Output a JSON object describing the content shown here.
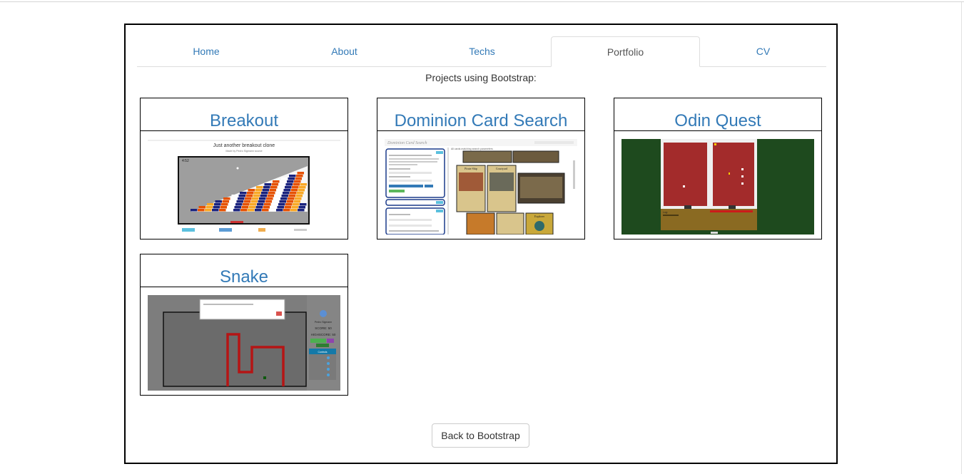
{
  "nav": {
    "tabs": [
      {
        "label": "Home"
      },
      {
        "label": "About"
      },
      {
        "label": "Techs"
      },
      {
        "label": "Portfolio"
      },
      {
        "label": "CV"
      }
    ],
    "active_tab": "Portfolio"
  },
  "portfolio": {
    "subtitle": "Projects using Bootstrap:",
    "projects": [
      {
        "title": "Breakout",
        "thumb_heading": "Just another breakout clone",
        "thumb_byline": "Made by Pedro Sigmann  source",
        "thumb_score": "4:52"
      },
      {
        "title": "Dominion Card Search",
        "thumb_brand": "Dominion Card Search",
        "thumb_results": "All cards matching search parameters",
        "thumb_card_names": [
          "Pirate Ship",
          "Courtyard",
          "Explorer"
        ]
      },
      {
        "title": "Odin Quest",
        "thumb_log_label": "Log:"
      },
      {
        "title": "Snake",
        "thumb_player": "Pedro Sigmann",
        "thumb_score": "SCORE: 50",
        "thumb_highscore": "HIGHSCORE: 50",
        "thumb_controls_label": "Controls"
      }
    ]
  },
  "actions": {
    "back_label": "Back to Bootstrap"
  },
  "colors": {
    "link": "#337ab7",
    "tab_active_text": "#555555",
    "frame_border": "#000000"
  }
}
